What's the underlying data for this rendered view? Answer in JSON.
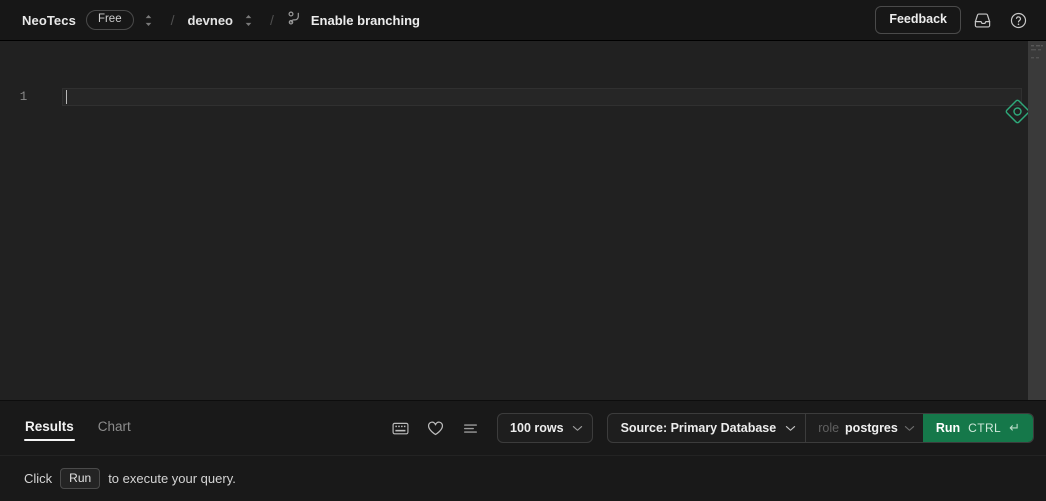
{
  "header": {
    "brand": "NeoTecs",
    "plan_badge": "Free",
    "separator": "/",
    "project": "devneo",
    "branch_action": "Enable branching",
    "feedback_label": "Feedback",
    "icons": {
      "plan_switcher": "chevron-up-down-icon",
      "project_switcher": "chevron-up-down-icon",
      "branch": "git-branch-icon",
      "inbox": "inbox-icon",
      "help": "help-circle-icon"
    }
  },
  "editor": {
    "line_numbers": [
      "1"
    ],
    "content": "",
    "ai_icon": "ai-diamond-icon"
  },
  "bottom_panel": {
    "tabs": [
      {
        "label": "Results",
        "active": true
      },
      {
        "label": "Chart",
        "active": false
      }
    ],
    "tool_icons": [
      {
        "name": "keyboard-shortcuts-icon"
      },
      {
        "name": "favorite-heart-icon"
      },
      {
        "name": "query-history-icon"
      }
    ],
    "rows_select": {
      "value": "100 rows"
    },
    "source_select": {
      "value": "Source: Primary Database"
    },
    "role_select": {
      "label": "role",
      "value": "postgres"
    },
    "run_button": {
      "label": "Run",
      "shortcut": "CTRL",
      "return_glyph": "↵"
    }
  },
  "status": {
    "prefix": "Click",
    "key": "Run",
    "suffix": "to execute your query."
  },
  "colors": {
    "header_bg": "#171717",
    "editor_bg": "#212121",
    "panel_bg": "#191919",
    "accent_green": "#15784a",
    "ai_green": "#2ea97a",
    "text_primary": "#ededed",
    "text_muted": "#8d8d8d"
  }
}
